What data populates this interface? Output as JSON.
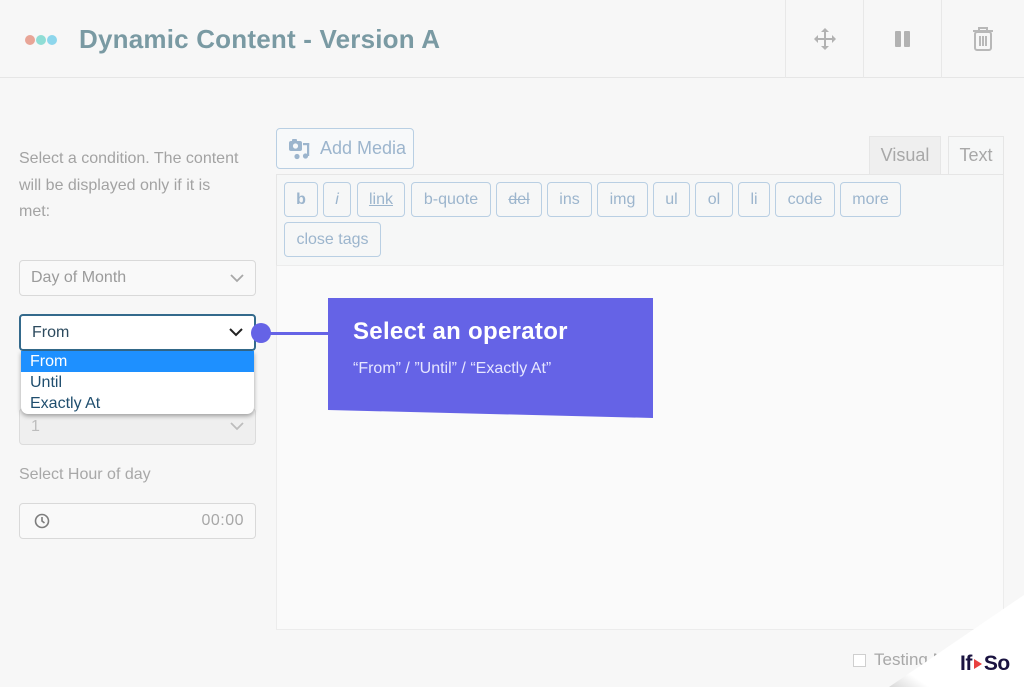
{
  "header": {
    "title": "Dynamic Content - Version A",
    "dots_colors": [
      "#e8a597",
      "#8fddd5",
      "#8dd6ec"
    ],
    "actions": [
      "move-icon",
      "pause-icon",
      "trash-icon"
    ]
  },
  "condition_panel": {
    "instructions": "Select a condition. The content will be displayed only if it is met:",
    "condition_select": {
      "value": "Day of Month"
    },
    "operator_select": {
      "value": "From",
      "options": [
        "From",
        "Until",
        "Exactly At"
      ],
      "highlighted": "From"
    },
    "day_select": {
      "value": "1"
    },
    "hour_label": "Select Hour of day",
    "time_input": {
      "value": "00:00"
    }
  },
  "editor": {
    "add_media_label": "Add Media",
    "tabs": [
      "Visual",
      "Text"
    ],
    "active_tab": "Text",
    "quicktags": [
      "b",
      "i",
      "link",
      "b-quote",
      "del",
      "ins",
      "img",
      "ul",
      "ol",
      "li",
      "code",
      "more",
      "close tags"
    ],
    "testing_label": "Testing M"
  },
  "callout": {
    "title": "Select an operator",
    "subtitle": "“From” / ”Until” / “Exactly At”",
    "color": "#6563e6"
  },
  "brand": {
    "logo_left": "If",
    "logo_right": "So",
    "arrow_color": "#e8403f"
  }
}
